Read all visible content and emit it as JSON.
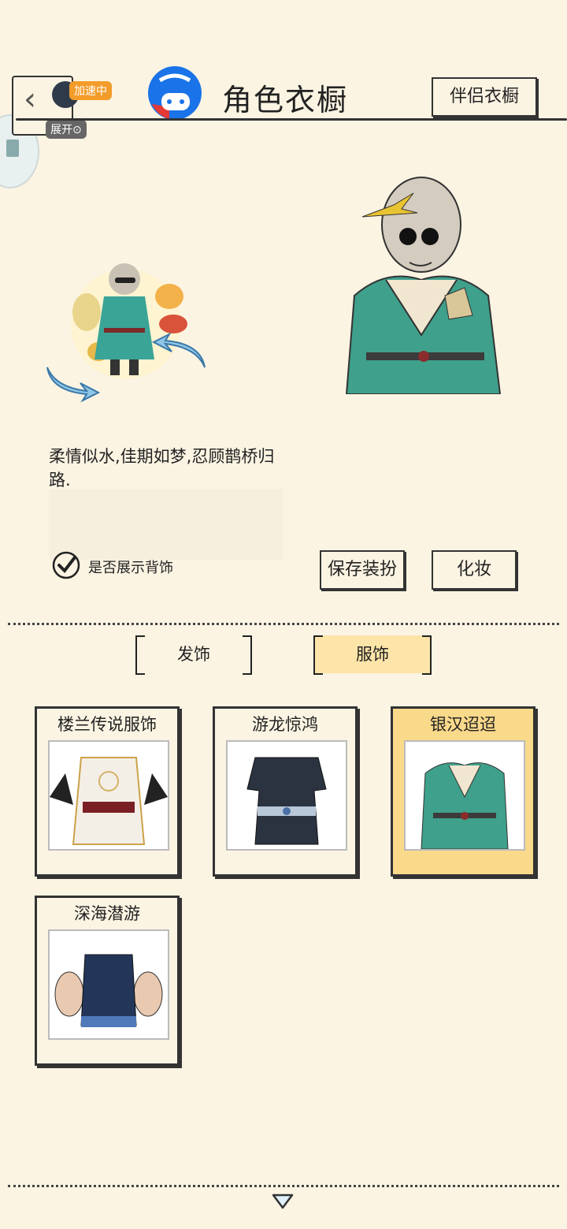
{
  "header": {
    "title": "角色衣橱",
    "partner_button": "伴侣衣橱",
    "boost_badge": "加速中",
    "expand_label": "展开⊙"
  },
  "preview": {
    "description": "柔情似水,佳期如梦,忍顾鹊桥归路.",
    "show_back_accessory_label": "是否展示背饰",
    "show_back_accessory_checked": true,
    "save_button": "保存装扮",
    "makeup_button": "化妆"
  },
  "tabs": [
    {
      "label": "发饰",
      "selected": false
    },
    {
      "label": "服饰",
      "selected": true
    }
  ],
  "outfits": [
    {
      "name": "楼兰传说服饰",
      "selected": false
    },
    {
      "name": "游龙惊鸿",
      "selected": false
    },
    {
      "name": "银汉迢迢",
      "selected": true
    },
    {
      "name": "深海潜游",
      "selected": false
    }
  ],
  "colors": {
    "background": "#fbf4e3",
    "selected": "#f9d98a",
    "tab_selected": "#fde4a8",
    "boost": "#f39c2a"
  }
}
